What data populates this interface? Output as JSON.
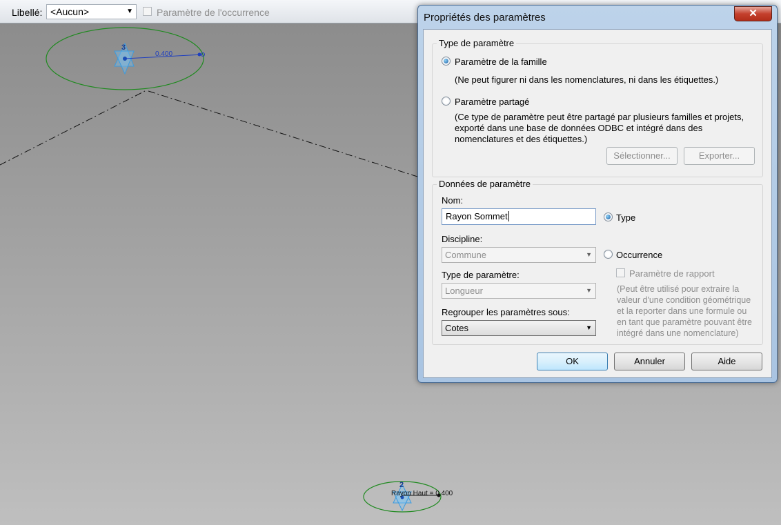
{
  "options_bar": {
    "label_text": "Libellé:",
    "label_value": "<Aucun>",
    "instance_checkbox_label": "Paramètre de l'occurrence"
  },
  "canvas": {
    "top_ref": {
      "number": "3",
      "value": "0.400"
    },
    "bottom_ref": {
      "number": "2",
      "dimension": "Rayon Haut = 0.400"
    }
  },
  "dialog": {
    "title": "Propriétés des paramètres",
    "close_label": "✕",
    "parameter_type": {
      "legend": "Type de paramètre",
      "family_label": "Paramètre de la famille",
      "family_desc": "(Ne peut figurer ni dans les nomenclatures, ni dans les étiquettes.)",
      "shared_label": "Paramètre partagé",
      "shared_desc_1": "(Ce type de paramètre peut être partagé par plusieurs familles et projets,",
      "shared_desc_2": "exporté dans une base de données ODBC et intégré dans des",
      "shared_desc_3": "nomenclatures et des étiquettes.)",
      "select_button": "Sélectionner...",
      "export_button": "Exporter..."
    },
    "parameter_data": {
      "legend": "Données de paramètre",
      "name_label": "Nom:",
      "name_value": "Rayon Sommet",
      "type_radio": "Type",
      "discipline_label": "Discipline:",
      "discipline_value": "Commune",
      "occurrence_radio": "Occurrence",
      "param_type_label": "Type de paramètre:",
      "param_type_value": "Longueur",
      "report_checkbox": "Paramètre de rapport",
      "report_desc_1": "(Peut être utilisé pour extraire la",
      "report_desc_2": "valeur d'une condition géométrique",
      "report_desc_3": "et la reporter dans une formule ou",
      "report_desc_4": "en tant que paramètre pouvant être",
      "report_desc_5": "intégré dans une nomenclature)",
      "group_label": "Regrouper les paramètres sous:",
      "group_value": "Cotes"
    },
    "buttons": {
      "ok": "OK",
      "cancel": "Annuler",
      "help": "Aide"
    }
  }
}
